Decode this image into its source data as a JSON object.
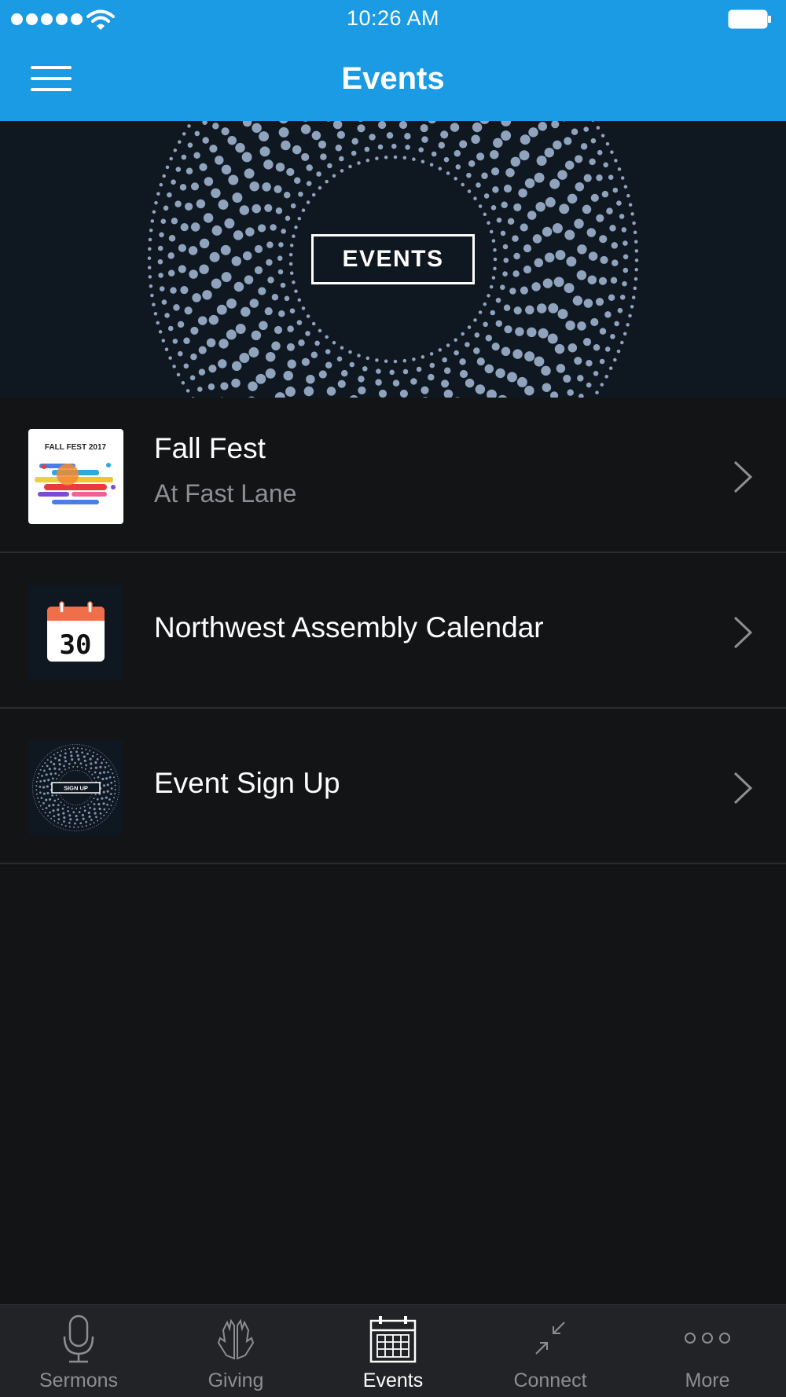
{
  "status_bar": {
    "time": "10:26 AM",
    "signal_icon": "signal-dots-icon",
    "wifi_icon": "wifi-icon",
    "battery_icon": "battery-icon"
  },
  "nav": {
    "title": "Events",
    "menu_icon": "hamburger-menu-icon"
  },
  "hero": {
    "label": "EVENTS"
  },
  "events": [
    {
      "title": "Fall Fest",
      "subtitle": "At Fast Lane",
      "thumb_icon": "fall-fest-2017-image",
      "thumb_text": "FALL FEST 2017"
    },
    {
      "title": "Northwest Assembly Calendar",
      "subtitle": "",
      "thumb_icon": "calendar-30-icon",
      "thumb_text": "30"
    },
    {
      "title": "Event Sign Up",
      "subtitle": "",
      "thumb_icon": "sign-up-image",
      "thumb_text": "SIGN UP"
    }
  ],
  "tabs": [
    {
      "label": "Sermons",
      "icon": "microphone-icon",
      "active": false
    },
    {
      "label": "Giving",
      "icon": "praying-hands-icon",
      "active": false
    },
    {
      "label": "Events",
      "icon": "calendar-icon",
      "active": true
    },
    {
      "label": "Connect",
      "icon": "arrows-connect-icon",
      "active": false
    },
    {
      "label": "More",
      "icon": "more-dots-icon",
      "active": false
    }
  ],
  "colors": {
    "accent": "#1b9be3",
    "background": "#131416",
    "hero_bg": "#0f1721",
    "tab_bar": "#222326",
    "muted_text": "#8e8f93"
  }
}
